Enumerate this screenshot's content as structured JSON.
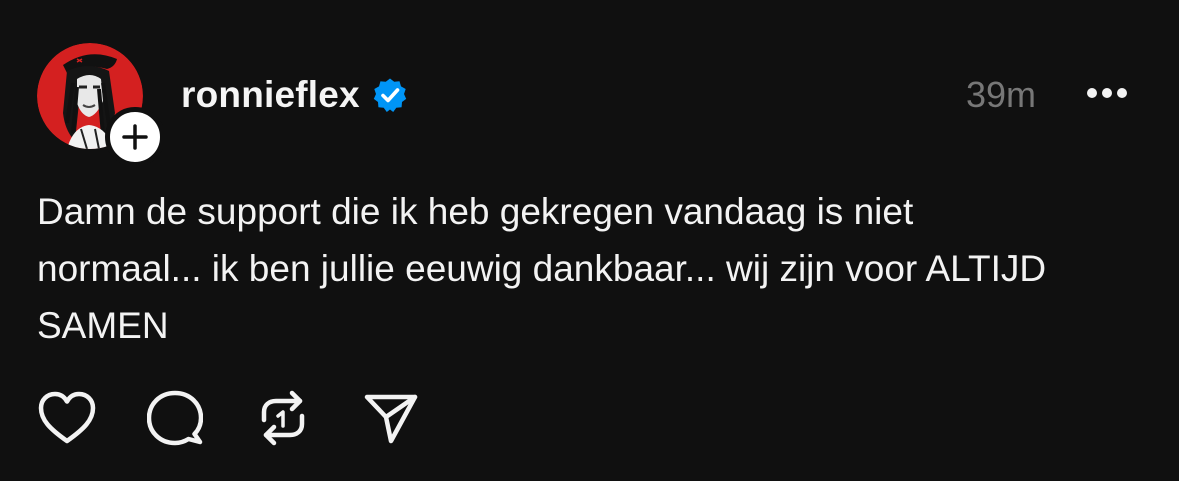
{
  "post": {
    "username": "ronnieflex",
    "verified": true,
    "timestamp": "39m",
    "text": "Damn de support die ik heb gekregen vandaag is niet\nnormaal... ik ben jullie eeuwig dankbaar... wij zijn voor ALTIJD\nSAMEN"
  },
  "icons": {
    "avatar": "profile-photo",
    "follow": "plus-icon",
    "verified": "verified-badge-icon",
    "more": "more-dots-icon",
    "like": "heart-icon",
    "reply": "comment-bubble-icon",
    "repost": "repost-icon",
    "share": "send-icon"
  },
  "colors": {
    "background": "#101010",
    "text": "#f3f3f3",
    "muted": "#777777",
    "verified": "#0095f6",
    "avatar_bg": "#d42020"
  }
}
